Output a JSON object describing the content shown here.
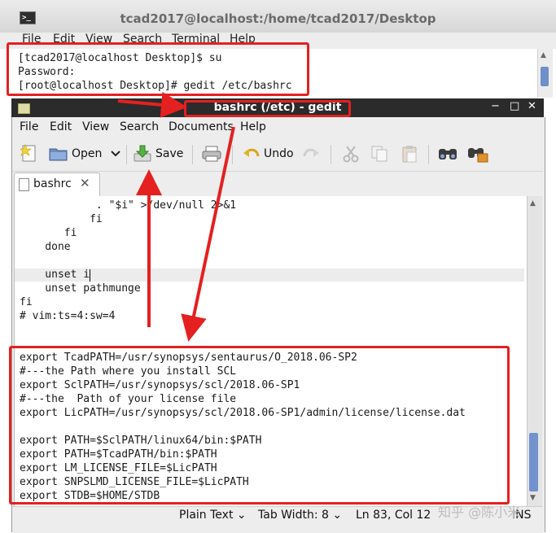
{
  "terminal": {
    "title": "tcad2017@localhost:/home/tcad2017/Desktop",
    "menu": [
      "File",
      "Edit",
      "View",
      "Search",
      "Terminal",
      "Help"
    ],
    "lines": [
      "[tcad2017@localhost Desktop]$ su",
      "Password:",
      "[root@localhost Desktop]# gedit /etc/bashrc"
    ]
  },
  "gedit": {
    "title": "bashrc (/etc) - gedit",
    "window_buttons": {
      "minimize": "−",
      "maximize": "□",
      "close": "✕"
    },
    "menu": [
      "File",
      "Edit",
      "View",
      "Search",
      "Documents",
      "Help"
    ],
    "toolbar": {
      "open": "Open",
      "save": "Save",
      "undo": "Undo"
    },
    "tab": {
      "label": "bashrc",
      "close": "✕"
    },
    "editor_lines": [
      "            . \"$i\" >/dev/null 2>&1",
      "           fi",
      "       fi",
      "    done",
      "",
      "    unset i",
      "    unset pathmunge",
      "fi",
      "# vim:ts=4:sw=4",
      "",
      "",
      "export TcadPATH=/usr/synopsys/sentaurus/O_2018.06-SP2",
      "#---the Path where you install SCL",
      "export SclPATH=/usr/synopsys/scl/2018.06-SP1",
      "#---the  Path of your license file",
      "export LicPATH=/usr/synopsys/scl/2018.06-SP1/admin/license/license.dat",
      "",
      "export PATH=$SclPATH/linux64/bin:$PATH",
      "export PATH=$TcadPATH/bin:$PATH",
      "export LM_LICENSE_FILE=$LicPATH",
      "export SNPSLMD_LICENSE_FILE=$LicPATH",
      "export STDB=$HOME/STDB"
    ],
    "status": {
      "language": "Plain Text ⌄",
      "tab_width": "Tab Width:  8 ⌄",
      "position": "Ln 83, Col 12",
      "mode": "INS"
    }
  },
  "watermark": "知乎 @陈小米",
  "colors": {
    "annotation_red": "#e52020",
    "gedit_titlebar": "#2b2b2b",
    "scroll_thumb": "#7393ce"
  }
}
